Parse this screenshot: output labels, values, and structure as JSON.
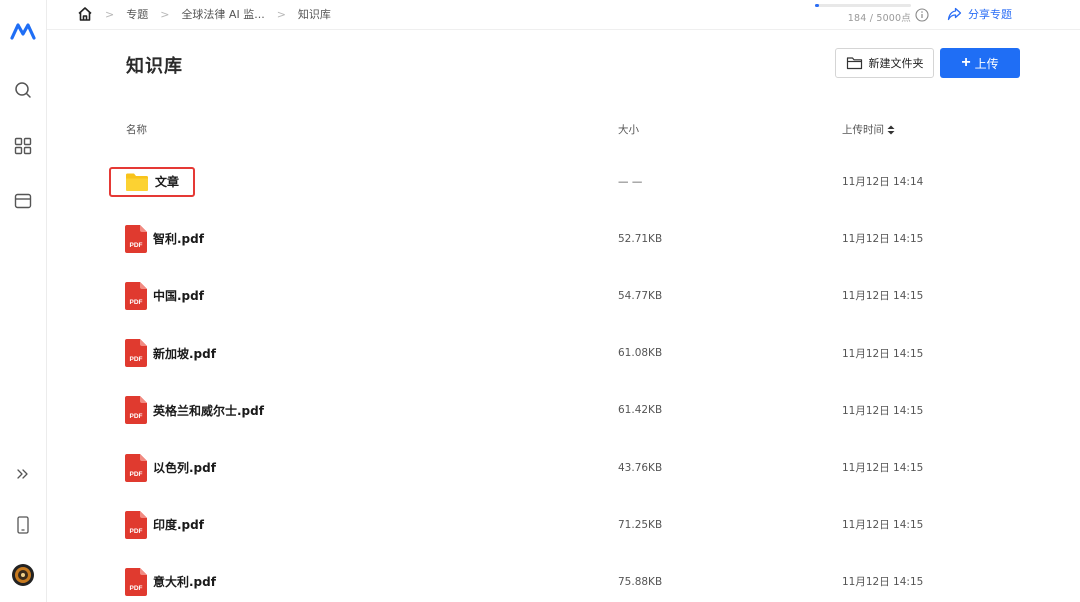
{
  "breadcrumb": {
    "items": [
      "专题",
      "全球法律 AI 监...",
      "知识库"
    ]
  },
  "quota": {
    "text": "184 / 5000点",
    "used": 184,
    "total": 5000
  },
  "share": {
    "label": "分享专题"
  },
  "page": {
    "title": "知识库"
  },
  "toolbar": {
    "new_folder_label": "新建文件夹",
    "upload_label": "上传"
  },
  "table": {
    "headers": {
      "name": "名称",
      "size": "大小",
      "time": "上传时间"
    },
    "rows": [
      {
        "type": "folder",
        "name": "文章",
        "size": "— —",
        "time": "11月12日 14:14"
      },
      {
        "type": "pdf",
        "name": "智利.pdf",
        "size": "52.71KB",
        "time": "11月12日 14:15"
      },
      {
        "type": "pdf",
        "name": "中国.pdf",
        "size": "54.77KB",
        "time": "11月12日 14:15"
      },
      {
        "type": "pdf",
        "name": "新加坡.pdf",
        "size": "61.08KB",
        "time": "11月12日 14:15"
      },
      {
        "type": "pdf",
        "name": "英格兰和威尔士.pdf",
        "size": "61.42KB",
        "time": "11月12日 14:15"
      },
      {
        "type": "pdf",
        "name": "以色列.pdf",
        "size": "43.76KB",
        "time": "11月12日 14:15"
      },
      {
        "type": "pdf",
        "name": "印度.pdf",
        "size": "71.25KB",
        "time": "11月12日 14:15"
      },
      {
        "type": "pdf",
        "name": "意大利.pdf",
        "size": "75.88KB",
        "time": "11月12日 14:15"
      }
    ]
  },
  "icons": {
    "pdf_badge": "PDF"
  },
  "colors": {
    "accent": "#1f6ef5",
    "folder": "#f8c31b",
    "pdf": "#e03a2f",
    "highlight": "#e53935"
  }
}
